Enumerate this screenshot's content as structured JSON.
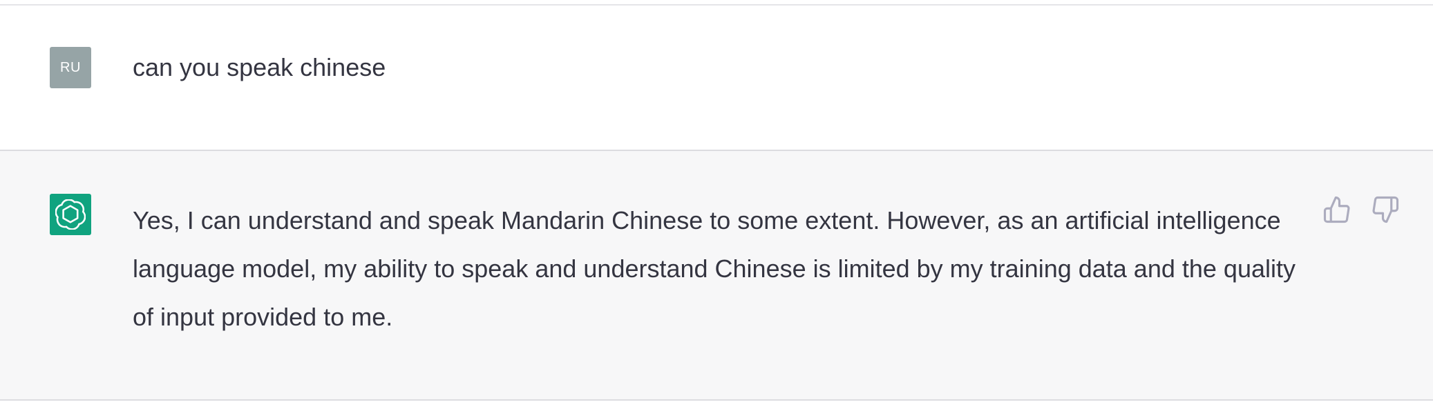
{
  "conversation": {
    "user": {
      "avatar_initials": "RU",
      "message": "can you speak chinese"
    },
    "assistant": {
      "avatar_icon": "openai-logo-icon",
      "message": "Yes, I can understand and speak Mandarin Chinese to some extent. However, as an artificial intelligence language model, my ability to speak and understand Chinese is limited by my training data and the quality of input provided to me."
    },
    "feedback": {
      "thumbs_up_icon": "thumbs-up-icon",
      "thumbs_down_icon": "thumbs-down-icon"
    }
  },
  "colors": {
    "assistant_bg": "#f7f7f8",
    "user_avatar_bg": "#96a4a6",
    "assistant_avatar_bg": "#10a37f",
    "text": "#343541",
    "icon": "#acacbe"
  }
}
